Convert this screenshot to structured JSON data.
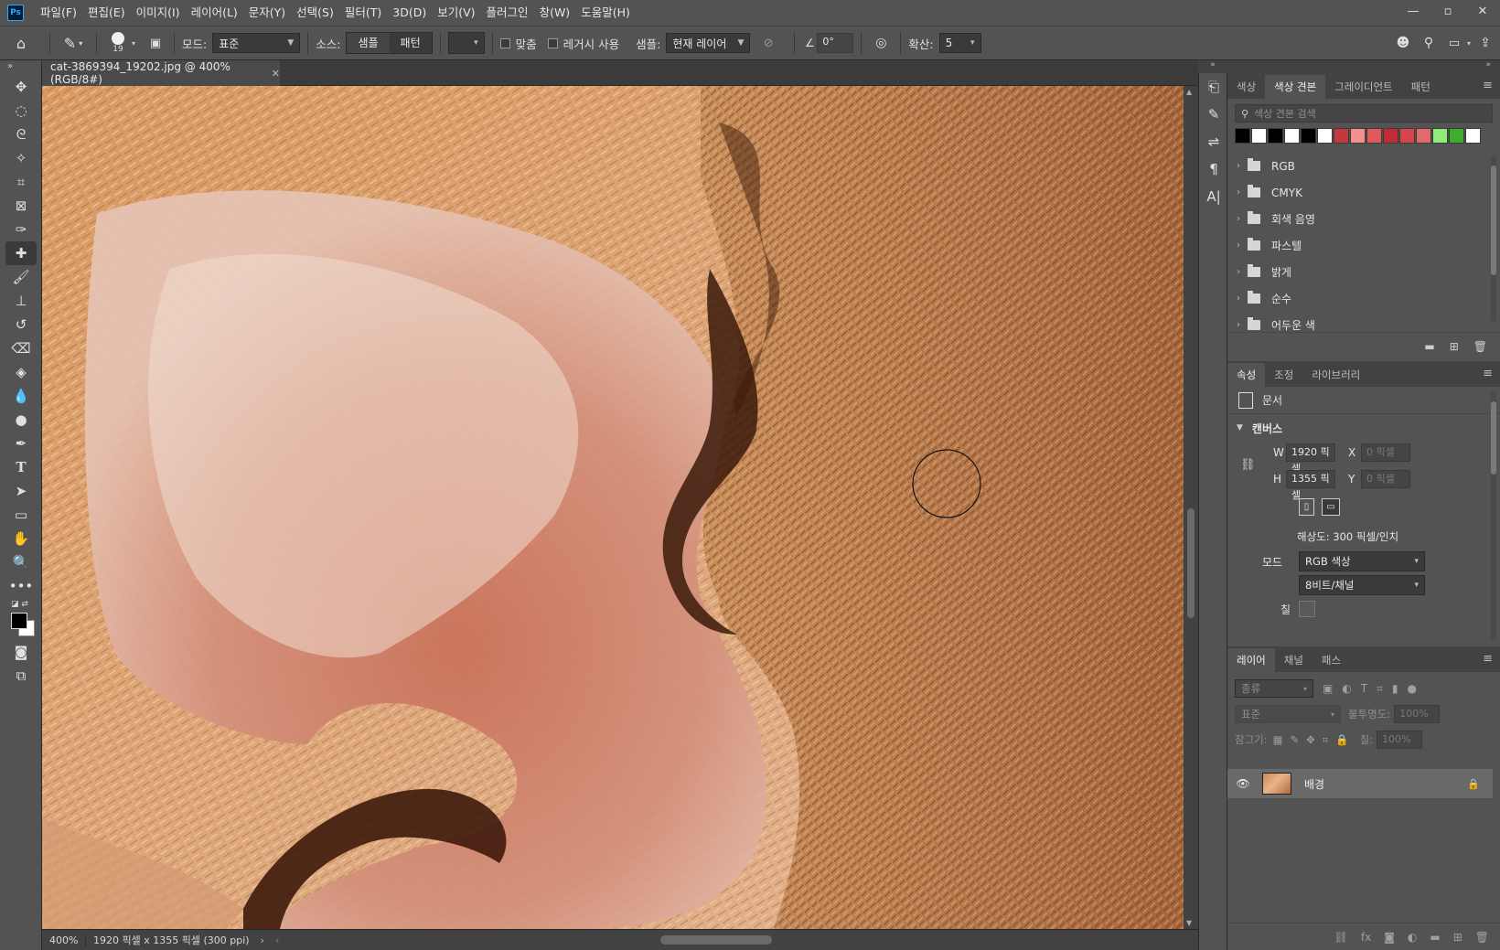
{
  "menubar": {
    "logo": "Ps",
    "items": [
      "파일(F)",
      "편집(E)",
      "이미지(I)",
      "레이어(L)",
      "문자(Y)",
      "선택(S)",
      "필터(T)",
      "3D(D)",
      "보기(V)",
      "플러그인",
      "창(W)",
      "도움말(H)"
    ],
    "window_controls": [
      "—",
      "▫",
      "✕"
    ]
  },
  "options": {
    "brush_size": "19",
    "mode_label": "모드:",
    "mode_value": "표준",
    "source_label": "소스:",
    "source_options": [
      "샘플",
      "패턴"
    ],
    "aligned_label": "맞춤",
    "legacy_label": "레거시 사용",
    "sample_label": "샘플:",
    "sample_value": "현재 레이어",
    "angle_value": "0°",
    "diffusion_label": "확산:",
    "diffusion_value": "5"
  },
  "document": {
    "tab_title": "cat-3869394_19202.jpg @ 400% (RGB/8#)",
    "status_zoom": "400%",
    "status_info": "1920 픽셀 x 1355 픽셀 (300 ppi)"
  },
  "swatches_panel": {
    "tabs": [
      "색상",
      "색상 견본",
      "그레이디언트",
      "패턴"
    ],
    "active_tab": 1,
    "search_placeholder": "색상 견본 검색",
    "colors": [
      "#000000",
      "#ffffff",
      "#000000",
      "#ffffff",
      "#000000",
      "#ffffff",
      "#c5383c",
      "#f28f8f",
      "#e05a5a",
      "#c42a33",
      "#d9434a",
      "#e26a6a",
      "#8fec7a",
      "#3cae2c",
      "#ffffff"
    ],
    "groups": [
      "RGB",
      "CMYK",
      "회색 음영",
      "파스텔",
      "밝게",
      "순수",
      "어두운 색"
    ]
  },
  "properties_panel": {
    "tabs": [
      "속성",
      "조정",
      "라이브러리"
    ],
    "active_tab": 0,
    "doc_label": "문서",
    "section_title": "캔버스",
    "w_label": "W",
    "w_value": "1920 픽셀",
    "h_label": "H",
    "h_value": "1355 픽셀",
    "x_label": "X",
    "x_value": "0 픽셀",
    "y_label": "Y",
    "y_value": "0 픽셀",
    "resolution": "해상도: 300 픽셀/인치",
    "mode_label": "모드",
    "mode_value": "RGB 색상",
    "depth_value": "8비트/채널",
    "fill_label": "칠"
  },
  "layers_panel": {
    "tabs": [
      "레이어",
      "채널",
      "패스"
    ],
    "active_tab": 0,
    "filter_label": "종류",
    "blend_mode": "표준",
    "opacity_label": "불투명도:",
    "opacity_value": "100%",
    "lock_label": "잠그기:",
    "fill_label": "칠:",
    "fill_value": "100%",
    "layer_name": "배경"
  },
  "colors": {
    "ui_dark": "#323232",
    "ui_panel": "#535353",
    "ps_blue": "#31a8ff"
  }
}
